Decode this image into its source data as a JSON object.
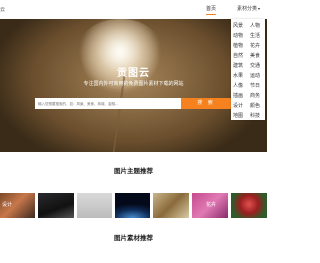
{
  "header": {
    "logo_text": "云",
    "nav_home": "首页",
    "nav_category": "素材分类",
    "nav_category_caret": "▾"
  },
  "dropdown": {
    "items": [
      "风景",
      "人物",
      "动物",
      "生活",
      "植物",
      "花卉",
      "自然",
      "美食",
      "建筑",
      "交通",
      "水果",
      "运动",
      "人像",
      "节日",
      "插画",
      "商务",
      "设计",
      "颜色",
      "地图",
      "科技"
    ]
  },
  "hero": {
    "title": "贡图云",
    "subtitle": "专注国内外可商用的免费图片素材下载的网站",
    "search_placeholder": "输入您想要搜索的，如：风景、美食、商城、金融...",
    "search_button": "搜 索"
  },
  "sections": {
    "themes_title": "图片主题推荐",
    "materials_title": "图片素材推荐"
  },
  "thumbnails": [
    {
      "label": "设计"
    },
    {
      "label": ""
    },
    {
      "label": ""
    },
    {
      "label": ""
    },
    {
      "label": ""
    },
    {
      "label": "花卉"
    },
    {
      "label": ""
    }
  ]
}
